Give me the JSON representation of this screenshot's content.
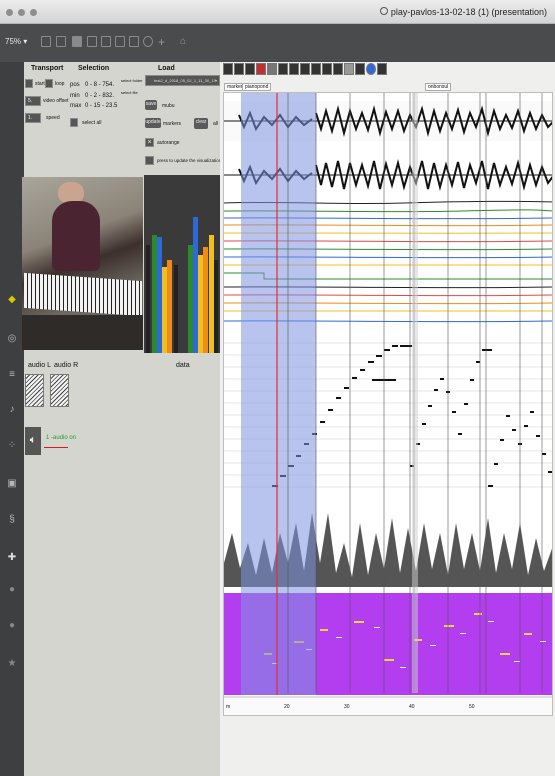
{
  "window": {
    "title": "play-pavlos-13-02-18 (1) (presentation)"
  },
  "toolbar": {
    "zoom": "75%"
  },
  "transport": {
    "header": "Transport",
    "start": "start",
    "loop": "loop",
    "video_offset": "video offset",
    "speed": "speed",
    "offset_value": "5.",
    "speed_value": "1."
  },
  "selection": {
    "header": "Selection",
    "pos_label": "pos",
    "pos_value": "0 - 8 - 754.",
    "min_label": "min",
    "min_value": "0 - 2 - 832.",
    "max_label": "max",
    "max_value": "0 - 15 - 23.5",
    "select_all": "select all"
  },
  "load": {
    "header": "Load",
    "select_folder": "select folder",
    "select_file": "select file",
    "file_value": "test2_d_2018_05_02_1_11_30_17",
    "save": "save",
    "mubu": "mubu",
    "update": "update",
    "markers": "markers",
    "clear": "clear",
    "all": "all",
    "autorange": "autorange",
    "press_update": "press to update the visualization"
  },
  "audio": {
    "left": "audio L",
    "right": "audio R",
    "audio_on": "1 -audio on",
    "data_label": "data"
  },
  "viz": {
    "track_tabs": [
      "markers",
      "pianopond"
    ],
    "right_tab": "onbonsul",
    "ruler_ticks": [
      "20",
      "20",
      "30",
      "40",
      "50"
    ],
    "ruler_start": "m"
  },
  "colors": {
    "selection": "#7f93e0",
    "playhead": "#e03030",
    "piano_roll_bg": "#b23ef0",
    "bar_green": "#2b8a2b",
    "bar_blue": "#2f68d8",
    "bar_yellow": "#f0c020",
    "bar_orange": "#f08a1a",
    "bar_black": "#222222"
  }
}
